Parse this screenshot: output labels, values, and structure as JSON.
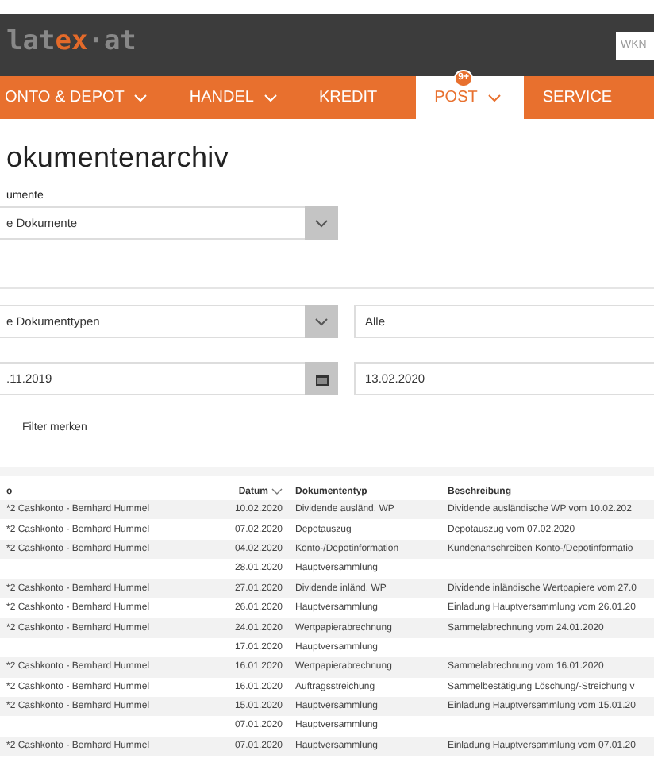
{
  "header": {
    "logo_main": "lat",
    "logo_accent": "ex",
    "logo_end": "·at",
    "search": {
      "placeholder": "WKN"
    }
  },
  "nav": [
    {
      "label": "ONTO & DEPOT",
      "dropdown": true,
      "selected": false
    },
    {
      "label": "HANDEL",
      "dropdown": true,
      "selected": false
    },
    {
      "label": "KREDIT",
      "dropdown": false,
      "selected": false
    },
    {
      "label": "POST",
      "dropdown": true,
      "selected": true,
      "badge": "9+"
    },
    {
      "label": "SERVICE",
      "dropdown": false,
      "selected": false
    }
  ],
  "title": "okumentenarchiv",
  "filters": {
    "documents_label": "umente",
    "documents_value": "e Dokumente",
    "type_value": "e Dokumenttypen",
    "status_value": "Alle",
    "date_from": ".11.2019",
    "date_to": "13.02.2020",
    "remember_filter": "Filter merken"
  },
  "table": {
    "columns": [
      "o",
      "Datum",
      "Dokumententyp",
      "Beschreibung"
    ],
    "rows": [
      {
        "account": "*2 Cashkonto - Bernhard Hummel",
        "date": "10.02.2020",
        "type": "Dividende ausländ. WP",
        "description": "Dividende ausländische WP vom 10.02.202"
      },
      {
        "account": "*2 Cashkonto - Bernhard Hummel",
        "date": "07.02.2020",
        "type": "Depotauszug",
        "description": "Depotauszug vom 07.02.2020"
      },
      {
        "account": "*2 Cashkonto - Bernhard Hummel",
        "date": "04.02.2020",
        "type": "Konto-/Depotinformation",
        "description": "Kundenanschreiben Konto-/Depotinformatio"
      },
      {
        "date": "28.01.2020",
        "type": "Hauptversammlung"
      },
      {
        "account": "*2 Cashkonto - Bernhard Hummel",
        "date": "27.01.2020",
        "type": "Dividende inländ. WP",
        "description": "Dividende inländische Wertpapiere vom 27.0"
      },
      {
        "account": "*2 Cashkonto - Bernhard Hummel",
        "date": "26.01.2020",
        "type": "Hauptversammlung",
        "description": "Einladung Hauptversammlung vom 26.01.20"
      },
      {
        "account": "*2 Cashkonto - Bernhard Hummel",
        "date": "24.01.2020",
        "type": "Wertpapierabrechnung",
        "description": "Sammelabrechnung vom 24.01.2020"
      },
      {
        "date": "17.01.2020",
        "type": "Hauptversammlung"
      },
      {
        "account": "*2 Cashkonto - Bernhard Hummel",
        "date": "16.01.2020",
        "type": "Wertpapierabrechnung",
        "description": "Sammelabrechnung vom 16.01.2020"
      },
      {
        "account": "*2 Cashkonto - Bernhard Hummel",
        "date": "16.01.2020",
        "type": "Auftragsstreichung",
        "description": "Sammelbestätigung Löschung/-Streichung v"
      },
      {
        "account": "*2 Cashkonto - Bernhard Hummel",
        "date": "15.01.2020",
        "type": "Hauptversammlung",
        "description": "Einladung Hauptversammlung vom 15.01.20"
      },
      {
        "date": "07.01.2020",
        "type": "Hauptversammlung"
      },
      {
        "account": "*2 Cashkonto - Bernhard Hummel",
        "date": "07.01.2020",
        "type": "Hauptversammlung",
        "description": "Einladung Hauptversammlung vom 07.01.20"
      }
    ]
  }
}
